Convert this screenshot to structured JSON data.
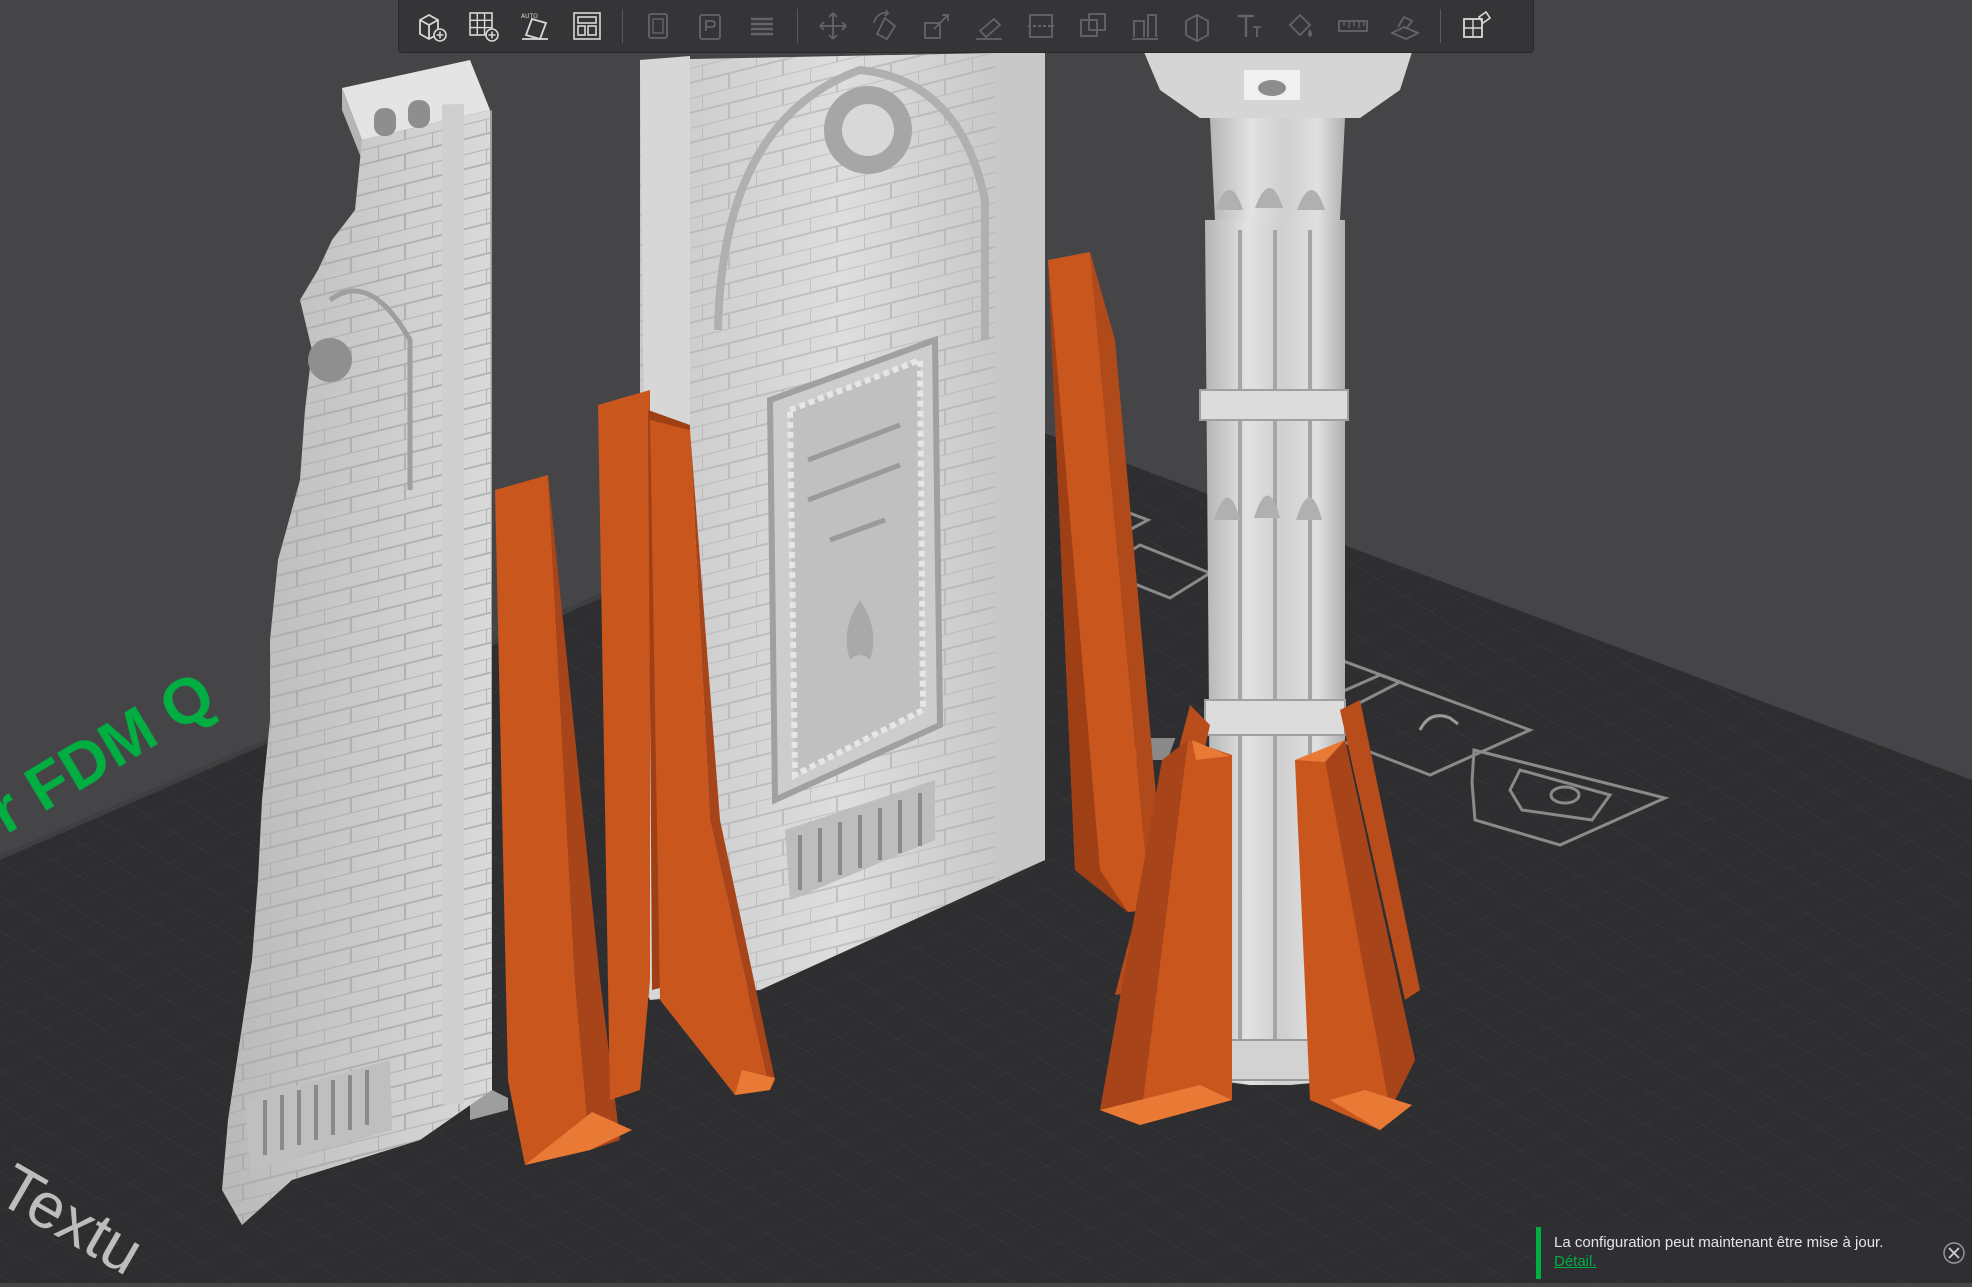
{
  "plate": {
    "watermark_side": "r FDM Q",
    "watermark_front": "Textu"
  },
  "toolbar": {
    "items": [
      {
        "name": "add-object",
        "icon": "add-cube-icon",
        "enabled": true
      },
      {
        "name": "add-plate",
        "icon": "add-plate-grid-icon",
        "enabled": true
      },
      {
        "name": "auto-orient",
        "icon": "auto-orient-icon",
        "enabled": true
      },
      {
        "name": "arrange",
        "icon": "arrange-icon",
        "enabled": true
      },
      {
        "name": "copy",
        "icon": "copy-icon",
        "enabled": false
      },
      {
        "name": "paste",
        "icon": "paste-icon",
        "enabled": false
      },
      {
        "name": "layers",
        "icon": "layers-icon",
        "enabled": false
      },
      {
        "name": "move",
        "icon": "move-icon",
        "enabled": false
      },
      {
        "name": "rotate",
        "icon": "rotate-icon",
        "enabled": false
      },
      {
        "name": "scale",
        "icon": "scale-icon",
        "enabled": false
      },
      {
        "name": "lay-on-face",
        "icon": "lay-on-face-icon",
        "enabled": false
      },
      {
        "name": "cut",
        "icon": "cut-icon",
        "enabled": false
      },
      {
        "name": "boolean",
        "icon": "boolean-icon",
        "enabled": false
      },
      {
        "name": "support-paint",
        "icon": "support-paint-icon",
        "enabled": false
      },
      {
        "name": "seam-paint",
        "icon": "seam-paint-icon",
        "enabled": false
      },
      {
        "name": "text",
        "icon": "text-icon",
        "enabled": false
      },
      {
        "name": "color-paint",
        "icon": "color-paint-icon",
        "enabled": false
      },
      {
        "name": "measure",
        "icon": "measure-icon",
        "enabled": false
      },
      {
        "name": "assembly",
        "icon": "assembly-icon",
        "enabled": false
      },
      {
        "name": "assembly-view",
        "icon": "assembly-view-icon",
        "enabled": true
      }
    ]
  },
  "notification": {
    "message": "La configuration peut maintenant être mise à jour.",
    "link": "Détail."
  },
  "colors": {
    "background": "#454548",
    "bed": "#2e2e30",
    "grid": "#3c3c3f",
    "model": "#d2d2d2",
    "support": "#c8561d",
    "accent": "#00ae42"
  }
}
